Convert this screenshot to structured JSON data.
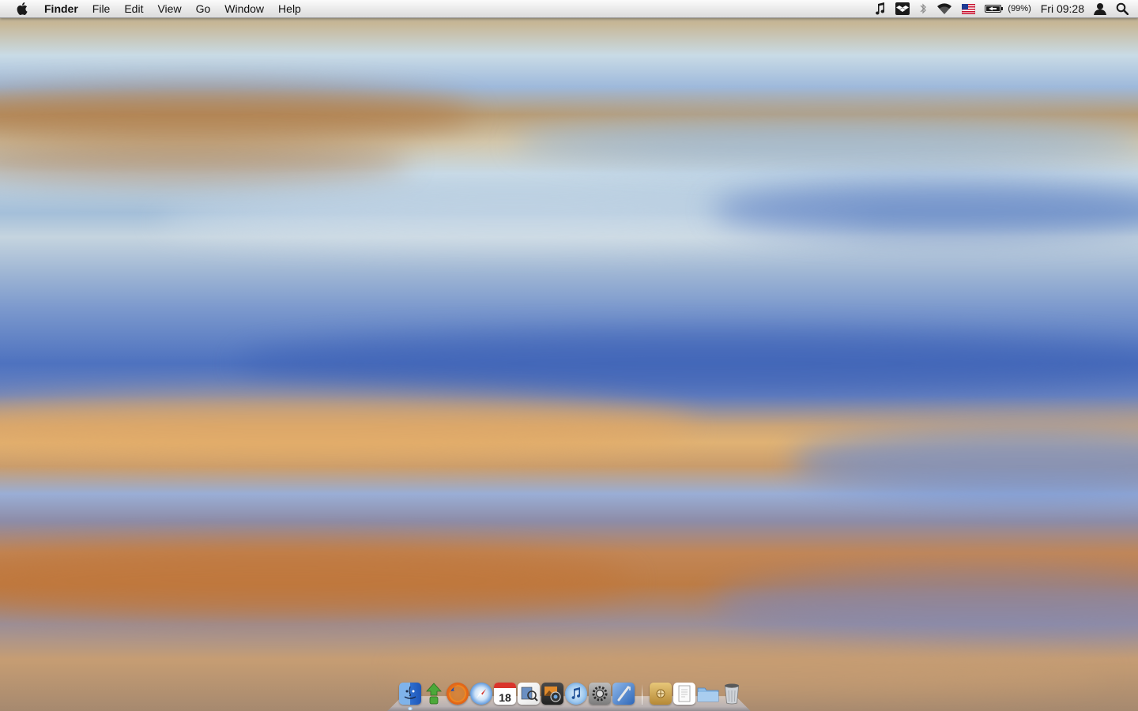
{
  "menubar": {
    "apple_icon": "apple-icon",
    "app_name": "Finder",
    "menus": [
      "File",
      "Edit",
      "View",
      "Go",
      "Window",
      "Help"
    ],
    "status": {
      "itunes_icon": "music-note-icon",
      "dropbox_icon": "dropbox-icon",
      "bluetooth_icon": "bluetooth-icon",
      "wifi_icon": "wifi-icon",
      "input_source_icon": "us-flag-icon",
      "battery_icon": "battery-icon",
      "battery_text": "(99%)",
      "clock": "Fri 09:28",
      "user_icon": "user-icon",
      "spotlight_icon": "search-icon"
    }
  },
  "dock": {
    "apps": [
      {
        "icon": "finder-icon",
        "running": true
      },
      {
        "icon": "transmission-icon",
        "running": false
      },
      {
        "icon": "firefox-icon",
        "running": false
      },
      {
        "icon": "safari-icon",
        "running": false
      },
      {
        "icon": "ical-icon",
        "date": "18",
        "running": false
      },
      {
        "icon": "preview-icon",
        "running": false
      },
      {
        "icon": "iphoto-icon",
        "running": false
      },
      {
        "icon": "itunes-icon",
        "running": false
      },
      {
        "icon": "system-preferences-icon",
        "running": false
      },
      {
        "icon": "xcode-icon",
        "running": false
      }
    ],
    "stacks": [
      {
        "icon": "applications-stack-icon"
      },
      {
        "icon": "documents-stack-icon"
      },
      {
        "icon": "downloads-folder-icon"
      },
      {
        "icon": "trash-icon"
      }
    ]
  },
  "colors": {
    "menubar_top": "#fbfbfb",
    "menubar_bottom": "#dcdcdc",
    "wallpaper_blue": "#4e72bf",
    "wallpaper_orange": "#bd7c45"
  }
}
